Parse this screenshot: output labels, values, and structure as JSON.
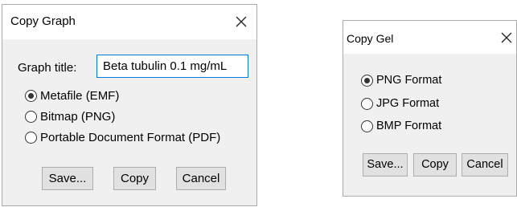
{
  "graph_dialog": {
    "title": "Copy Graph",
    "graph_title_label": "Graph title:",
    "graph_title_value": "Beta tubulin 0.1 mg/mL",
    "options": [
      {
        "label": "Metafile (EMF)",
        "checked": true
      },
      {
        "label": "Bitmap (PNG)",
        "checked": false
      },
      {
        "label": "Portable Document Format (PDF)",
        "checked": false
      }
    ],
    "buttons": {
      "save": "Save...",
      "copy": "Copy",
      "cancel": "Cancel"
    },
    "close_icon": "close-icon"
  },
  "gel_dialog": {
    "title": "Copy Gel",
    "options": [
      {
        "label": "PNG Format",
        "checked": true
      },
      {
        "label": "JPG Format",
        "checked": false
      },
      {
        "label": "BMP Format",
        "checked": false
      }
    ],
    "buttons": {
      "save": "Save...",
      "copy": "Copy",
      "cancel": "Cancel"
    },
    "close_icon": "close-icon"
  },
  "colors": {
    "dialog_bg": "#f0f0f0",
    "titlebar_bg": "#ffffff",
    "textbox_focus_border": "#0078d7",
    "button_bg": "#e1e1e1",
    "button_border": "#adadad"
  }
}
